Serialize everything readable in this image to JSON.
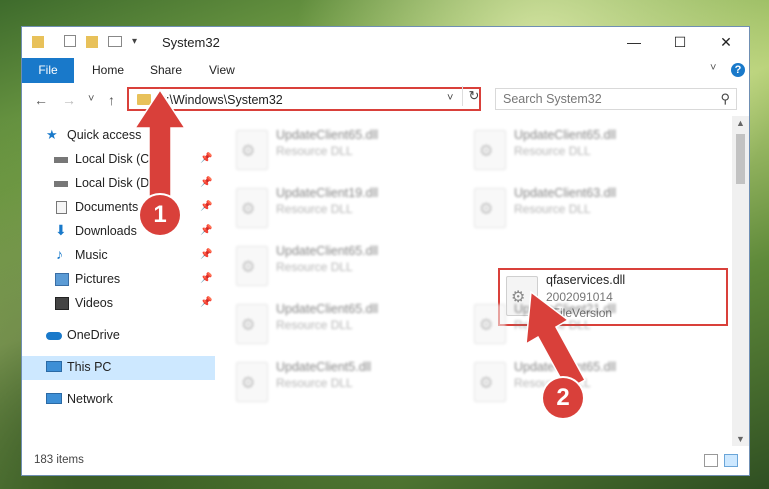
{
  "window": {
    "title": "System32",
    "minimize": "—",
    "maximize": "☐",
    "close": "✕"
  },
  "ribbon": {
    "file": "File",
    "tabs": [
      "Home",
      "Share",
      "View"
    ],
    "help": "?"
  },
  "nav": {
    "back": "←",
    "forward": "→",
    "recent": "˅",
    "up": "↑",
    "address_path": "C:\\Windows\\System32",
    "refresh": "↻",
    "search_placeholder": "Search System32",
    "search_icon": "⚲"
  },
  "sidebar": {
    "items": [
      {
        "label": "Quick access",
        "icon": "star-icon"
      },
      {
        "label": "Local Disk (C:)",
        "icon": "drive-icon",
        "pinned": true
      },
      {
        "label": "Local Disk (D:)",
        "icon": "drive-icon",
        "pinned": true
      },
      {
        "label": "Documents",
        "icon": "documents-icon",
        "pinned": true
      },
      {
        "label": "Downloads",
        "icon": "downloads-icon",
        "pinned": true
      },
      {
        "label": "Music",
        "icon": "music-icon",
        "pinned": true
      },
      {
        "label": "Pictures",
        "icon": "pictures-icon",
        "pinned": true
      },
      {
        "label": "Videos",
        "icon": "videos-icon",
        "pinned": true
      },
      {
        "label": "OneDrive",
        "icon": "onedrive-icon"
      },
      {
        "label": "This PC",
        "icon": "pc-icon",
        "selected": true
      },
      {
        "label": "Network",
        "icon": "network-icon"
      }
    ]
  },
  "files": [
    {
      "name": "UpdateClient65.dll",
      "type": "Resource DLL"
    },
    {
      "name": "UpdateClient65.dll",
      "type": "Resource DLL"
    },
    {
      "name": "UpdateClient19.dll",
      "type": "Resource DLL"
    },
    {
      "name": "UpdateClient63.dll",
      "type": "Resource DLL"
    },
    {
      "name": "UpdateClient65.dll",
      "type": "Resource DLL"
    },
    {
      "name": "qfaservices.dll",
      "version": "2002091014",
      "type": "6FileVersion"
    },
    {
      "name": "UpdateClient65.dll",
      "type": "Resource DLL"
    },
    {
      "name": "UpdateClient21.dll",
      "type": "Resource DLL"
    },
    {
      "name": "UpdateClient5.dll",
      "type": "Resource DLL"
    },
    {
      "name": "UpdateClient65.dll",
      "type": "Resource DLL"
    }
  ],
  "status": {
    "items": "183 items"
  },
  "annotations": {
    "badge1": "1",
    "badge2": "2"
  },
  "colors": {
    "accent": "#1979ca",
    "highlight": "#d9403a",
    "selected": "#cde8ff"
  }
}
